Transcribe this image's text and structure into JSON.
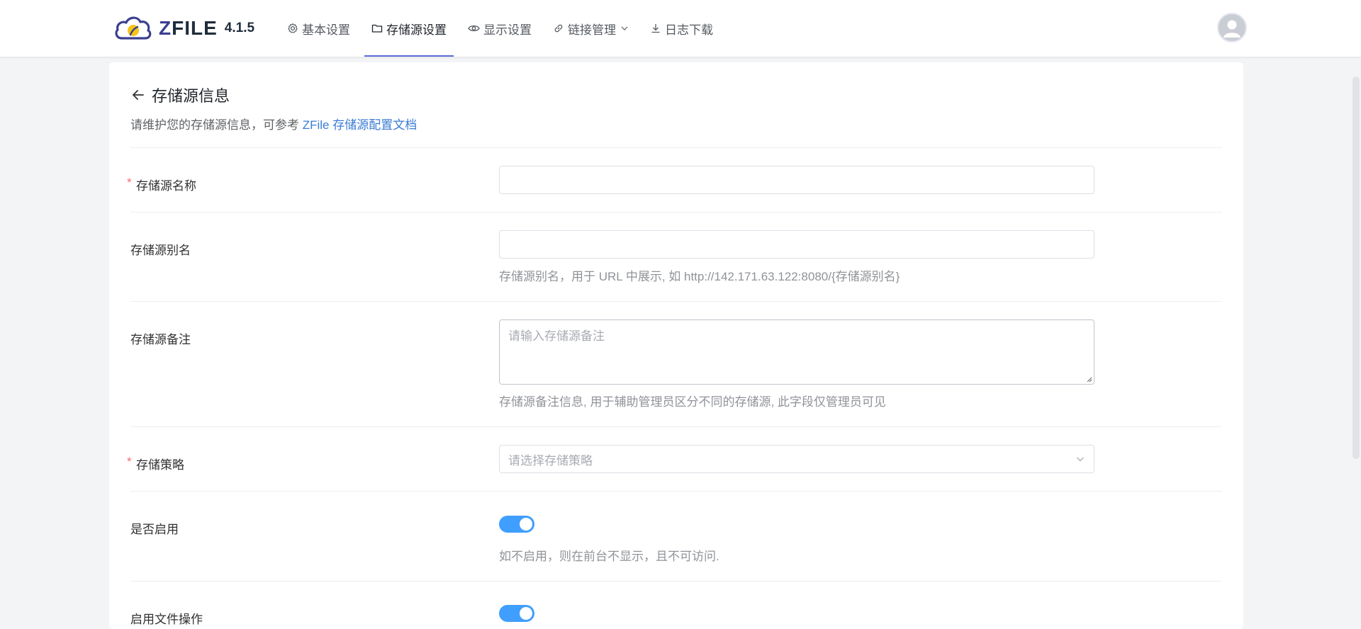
{
  "app": {
    "brand": "ZFILE",
    "version": "4.1.5"
  },
  "nav": {
    "items": [
      {
        "label": "基本设置",
        "icon": "gear-icon"
      },
      {
        "label": "存储源设置",
        "icon": "folder-icon",
        "active": true
      },
      {
        "label": "显示设置",
        "icon": "eye-icon"
      },
      {
        "label": "链接管理",
        "icon": "link-icon",
        "has_dropdown": true
      },
      {
        "label": "日志下载",
        "icon": "download-icon"
      }
    ]
  },
  "page": {
    "title": "存储源信息",
    "subtitle_prefix": "请维护您的存储源信息，可参考 ",
    "doc_link": "ZFile 存储源配置文档"
  },
  "form": {
    "name": {
      "label": "存储源名称",
      "required": true,
      "value": ""
    },
    "alias": {
      "label": "存储源别名",
      "value": "",
      "hint": "存储源别名，用于 URL 中展示, 如 http://142.171.63.122:8080/{存储源别名}"
    },
    "remark": {
      "label": "存储源备注",
      "placeholder": "请输入存储源备注",
      "hint": "存储源备注信息, 用于辅助管理员区分不同的存储源, 此字段仅管理员可见"
    },
    "strategy": {
      "label": "存储策略",
      "required": true,
      "placeholder": "请选择存储策略"
    },
    "enabled": {
      "label": "是否启用",
      "on": true,
      "hint": "如不启用，则在前台不显示，且不可访问."
    },
    "file_ops": {
      "label": "启用文件操作",
      "on": true
    }
  },
  "colors": {
    "accent": "#409eff",
    "link": "#3a7bd5",
    "nav_active_underline": "#5b6bd6",
    "required": "#f56c6c"
  }
}
